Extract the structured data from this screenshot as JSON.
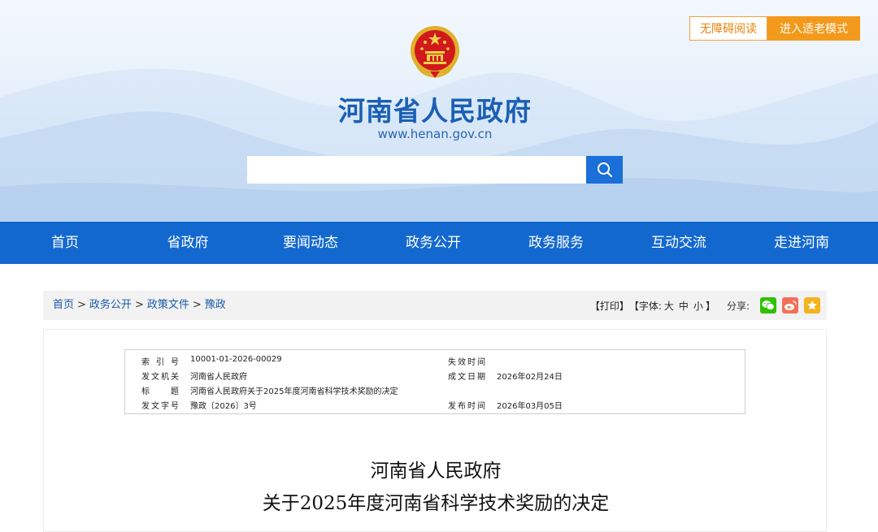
{
  "header": {
    "accessibility_label": "无障碍阅读",
    "elder_mode_label": "进入适老模式",
    "site_title": "河南省人民政府",
    "site_url": "www.henan.gov.cn",
    "search": {
      "placeholder": ""
    }
  },
  "nav": {
    "items": [
      "首页",
      "省政府",
      "要闻动态",
      "政务公开",
      "政务服务",
      "互动交流",
      "走进河南"
    ]
  },
  "breadcrumb": {
    "items": [
      "首页",
      "政务公开",
      "政策文件",
      "豫政"
    ],
    "separator": ">"
  },
  "tools": {
    "print": "【打印】",
    "font_prefix": "【字体:",
    "font_large": "大",
    "font_medium": "中",
    "font_small": "小",
    "font_suffix": "】",
    "share_label": "分享:"
  },
  "share_icons": [
    "wechat-icon",
    "weibo-icon",
    "favorite-icon"
  ],
  "meta": {
    "index_label": "索引号",
    "index_value": "10001-01-2026-00029",
    "expire_label": "失效时间",
    "expire_value": "",
    "issuer_label": "发文机关",
    "issuer_value": "河南省人民政府",
    "written_label": "成文日期",
    "written_value": "2026年02月24日",
    "title_label": "标题",
    "title_value": "河南省人民政府关于2025年度河南省科学技术奖励的决定",
    "docno_label": "发文字号",
    "docno_value": "豫政〔2026〕3号",
    "publish_label": "发布时间",
    "publish_value": "2026年03月05日"
  },
  "document": {
    "title_line1": "河南省人民政府",
    "title_line2": "关于2025年度河南省科学技术奖励的决定"
  },
  "colors": {
    "nav_blue": "#1268cf",
    "title_blue": "#1a5fb4",
    "orange": "#f39a1c",
    "wechat": "#2dc100",
    "weibo": "#f2705a",
    "favorite": "#f5b21e"
  }
}
